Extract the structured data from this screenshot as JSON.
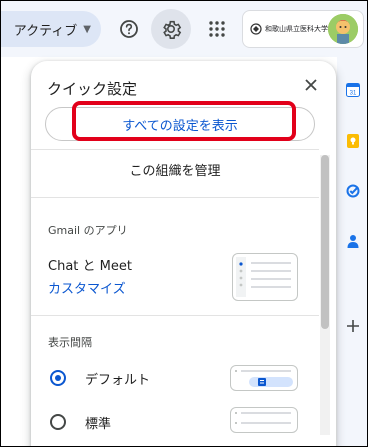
{
  "topbar": {
    "status_label": "アクティブ",
    "status_chevron": "chevron-down-icon",
    "help_icon": "help-icon",
    "settings_icon": "gear-icon",
    "apps_icon": "apps-grid-icon",
    "org_name": "和歌山県立医科大学"
  },
  "quick_settings": {
    "title": "クイック設定",
    "close_icon": "close-icon",
    "see_all_label": "すべての設定を表示",
    "manage_org_label": "この組織を管理",
    "gmail_apps_section": "Gmail のアプリ",
    "chat_meet_label": "Chat と Meet",
    "customize_label": "カスタマイズ",
    "density_section": "表示間隔",
    "density_options": [
      {
        "label": "デフォルト",
        "selected": true
      },
      {
        "label": "標準",
        "selected": false
      }
    ]
  },
  "side_panel": {
    "icons": [
      "calendar-icon",
      "keep-icon",
      "tasks-icon",
      "contacts-icon",
      "add-icon"
    ]
  },
  "colors": {
    "accent": "#0b57d0",
    "highlight_box": "#e2001a",
    "topbar_bg": "#f3f6fc"
  }
}
